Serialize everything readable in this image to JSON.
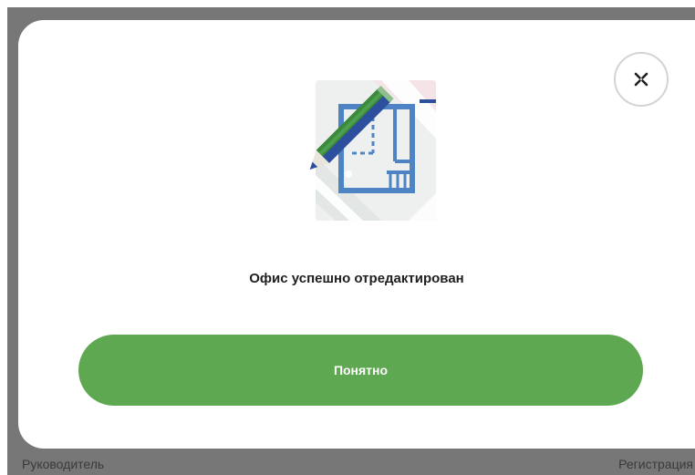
{
  "background": {
    "left_text": "Руководитель",
    "right_text": "Регистрация"
  },
  "modal": {
    "close_icon": "close-x-icon",
    "illustration_icon": "edit-blueprint-icon",
    "message": "Офис успешно отредактирован",
    "confirm_label": "Понятно"
  },
  "colors": {
    "accent": "#5fa852",
    "pencil_green": "#3a8a3a",
    "pencil_blue": "#2c4f9e",
    "blueprint_blue": "#4e83c4",
    "backdrop": "#777777"
  }
}
